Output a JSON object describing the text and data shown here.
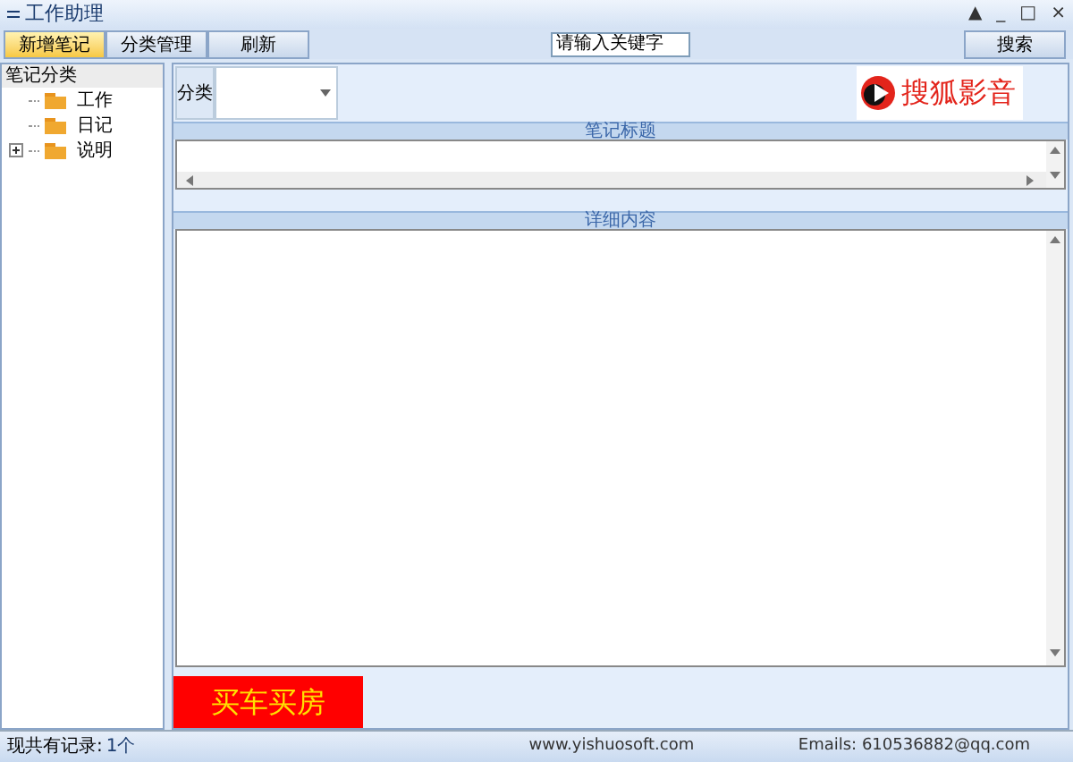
{
  "window": {
    "title": "工作助理",
    "controls": [
      "▲",
      "_",
      "□",
      "×"
    ]
  },
  "toolbar": {
    "buttons": [
      {
        "label": "新增笔记",
        "selected": true
      },
      {
        "label": "分类管理",
        "selected": false
      },
      {
        "label": "刷新",
        "selected": false
      }
    ],
    "search": {
      "placeholder": "请输入关键字"
    },
    "search_button": "搜索"
  },
  "sidebar": {
    "title": "笔记分类",
    "items": [
      {
        "label": "工作",
        "expandable": false
      },
      {
        "label": "日记",
        "expandable": false
      },
      {
        "label": "说明",
        "expandable": true
      }
    ]
  },
  "category": {
    "label": "分类"
  },
  "ad_top": {
    "text": "搜狐影音"
  },
  "title_section": {
    "header": "笔记标题"
  },
  "content_section": {
    "header": "详细内容"
  },
  "ad_bottom": {
    "text": "买车买房"
  },
  "status_bar": {
    "records_label": "现共有记录:",
    "records_value": "1个",
    "website": "www.yishuosoft.com",
    "email": "Emails: 610536882@qq.com"
  }
}
